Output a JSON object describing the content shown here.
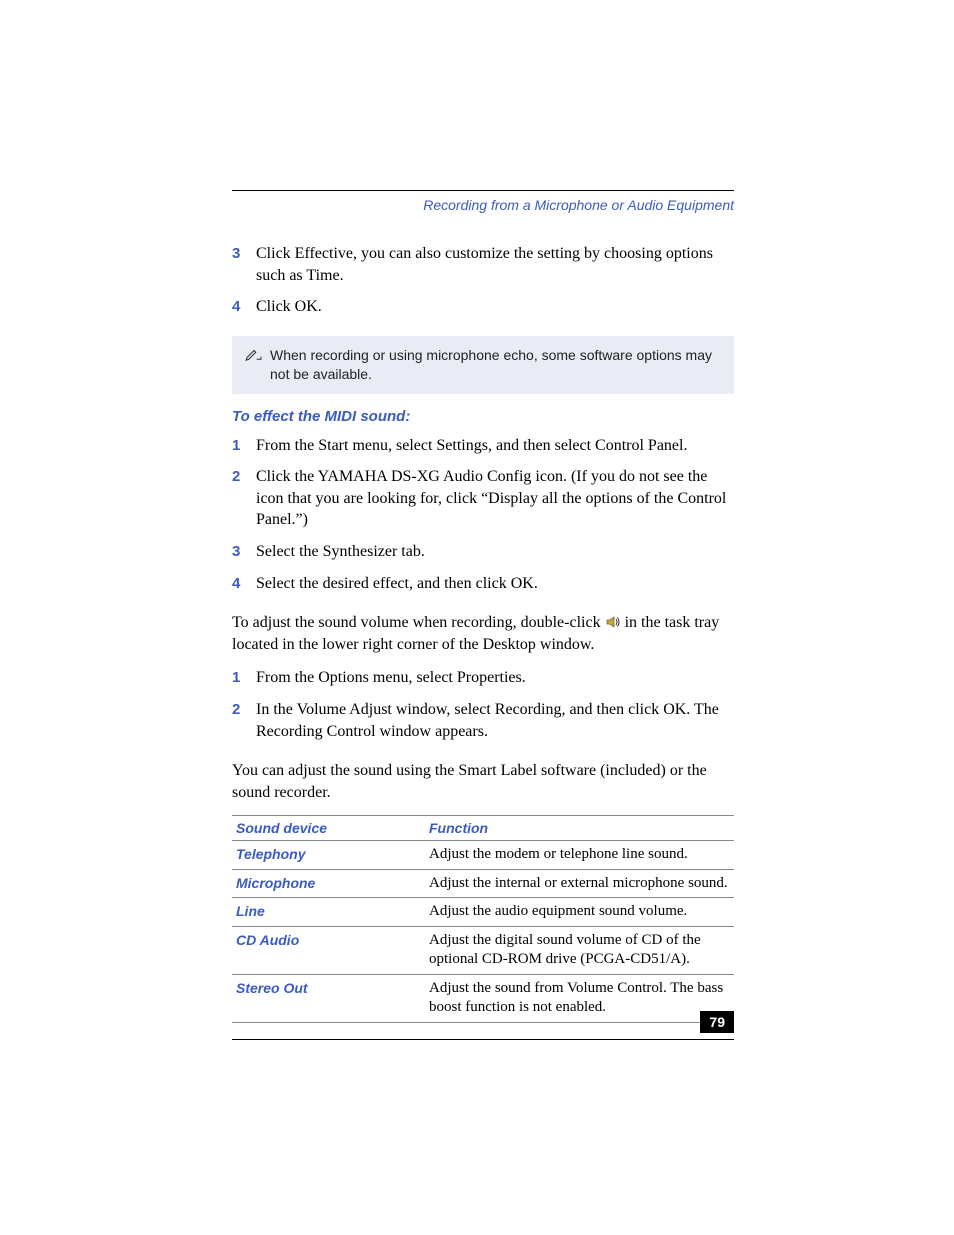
{
  "header": {
    "title": "Recording from a Microphone or Audio Equipment"
  },
  "steps1": [
    {
      "num": "3",
      "text": "Click Effective, you can also customize the setting by choosing options such as Time."
    },
    {
      "num": "4",
      "text": "Click OK."
    }
  ],
  "note": {
    "text": "When recording or using microphone echo, some software options may not be available."
  },
  "subhead1": "To effect the MIDI sound:",
  "steps2": [
    {
      "num": "1",
      "text": "From the Start menu, select Settings, and then select Control Panel."
    },
    {
      "num": "2",
      "text": "Click the YAMAHA DS-XG Audio Config icon. (If you do not see the icon that you are looking for, click “Display all the options of the Control Panel.”)"
    },
    {
      "num": "3",
      "text": "Select the Synthesizer tab."
    },
    {
      "num": "4",
      "text": "Select the desired effect, and then click OK."
    }
  ],
  "para1_a": "To adjust the sound volume when recording, double-click ",
  "para1_b": " in the task tray located in the lower right corner of the Desktop window.",
  "steps3": [
    {
      "num": "1",
      "text": "From the Options menu, select Properties."
    },
    {
      "num": "2",
      "text": "In the Volume Adjust window, select Recording, and then click OK. The Recording Control window appears."
    }
  ],
  "para2": "You can adjust the sound using the Smart Label software (included) or the sound recorder.",
  "table": {
    "headers": [
      "Sound device",
      "Function"
    ],
    "rows": [
      {
        "device": "Telephony",
        "function": "Adjust the modem or telephone line sound."
      },
      {
        "device": "Microphone",
        "function": "Adjust the internal or external microphone sound."
      },
      {
        "device": "Line",
        "function": "Adjust the audio equipment sound volume."
      },
      {
        "device": "CD Audio",
        "function": "Adjust the digital sound volume of CD of the optional CD-ROM drive (PCGA-CD51/A)."
      },
      {
        "device": "Stereo Out",
        "function": "Adjust the sound from Volume Control. The bass boost function is not enabled."
      }
    ]
  },
  "page_number": "79"
}
